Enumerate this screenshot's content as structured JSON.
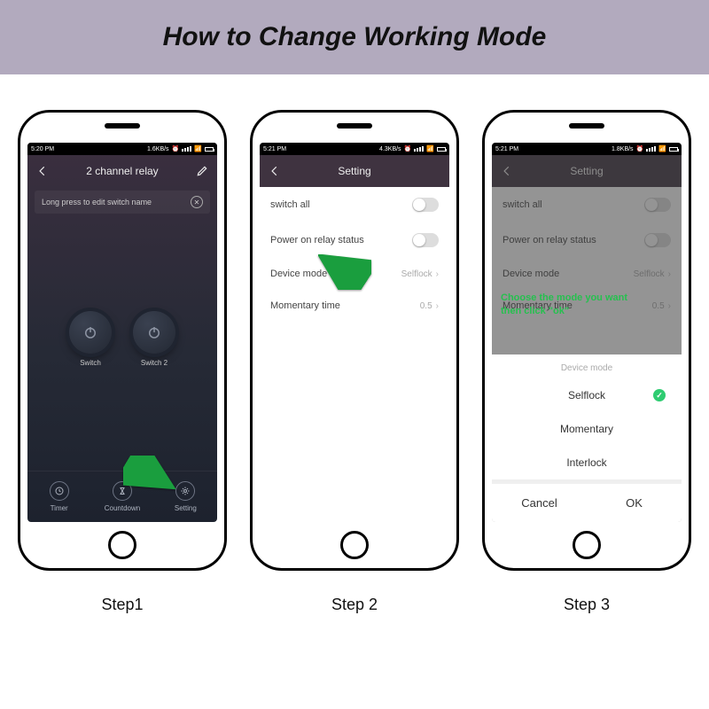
{
  "banner": {
    "title": "How to Change Working Mode"
  },
  "labels": {
    "step1": "Step1",
    "step2": "Step 2",
    "step3": "Step 3"
  },
  "status": {
    "time1": "5:20 PM",
    "rate1": "1.6KB/s",
    "time2": "5:21 PM",
    "rate2": "4.3KB/s",
    "time3": "5:21 PM",
    "rate3": "1.8KB/s"
  },
  "step1": {
    "title": "2 channel relay",
    "hint": "Long press to edit switch name",
    "switch1": "Switch",
    "switch2": "Switch 2",
    "tabs": {
      "timer": "Timer",
      "countdown": "Countdown",
      "setting": "Setting"
    }
  },
  "step2": {
    "title": "Setting",
    "rows": {
      "switch_all": "switch all",
      "power_on": "Power on relay status",
      "device_mode": "Device mode",
      "device_mode_val": "Selflock",
      "momentary": "Momentary time",
      "momentary_val": "0.5"
    }
  },
  "step3": {
    "title": "Setting",
    "rows": {
      "switch_all": "switch all",
      "power_on": "Power on relay status",
      "device_mode": "Device mode",
      "device_mode_val": "Selflock",
      "momentary": "Momentary time",
      "momentary_val": "0.5"
    },
    "hint": "Choose the mode you want\nthen click \"ok\"",
    "sheet": {
      "title": "Device mode",
      "opt1": "Selflock",
      "opt2": "Momentary",
      "opt3": "Interlock",
      "cancel": "Cancel",
      "ok": "OK"
    }
  }
}
